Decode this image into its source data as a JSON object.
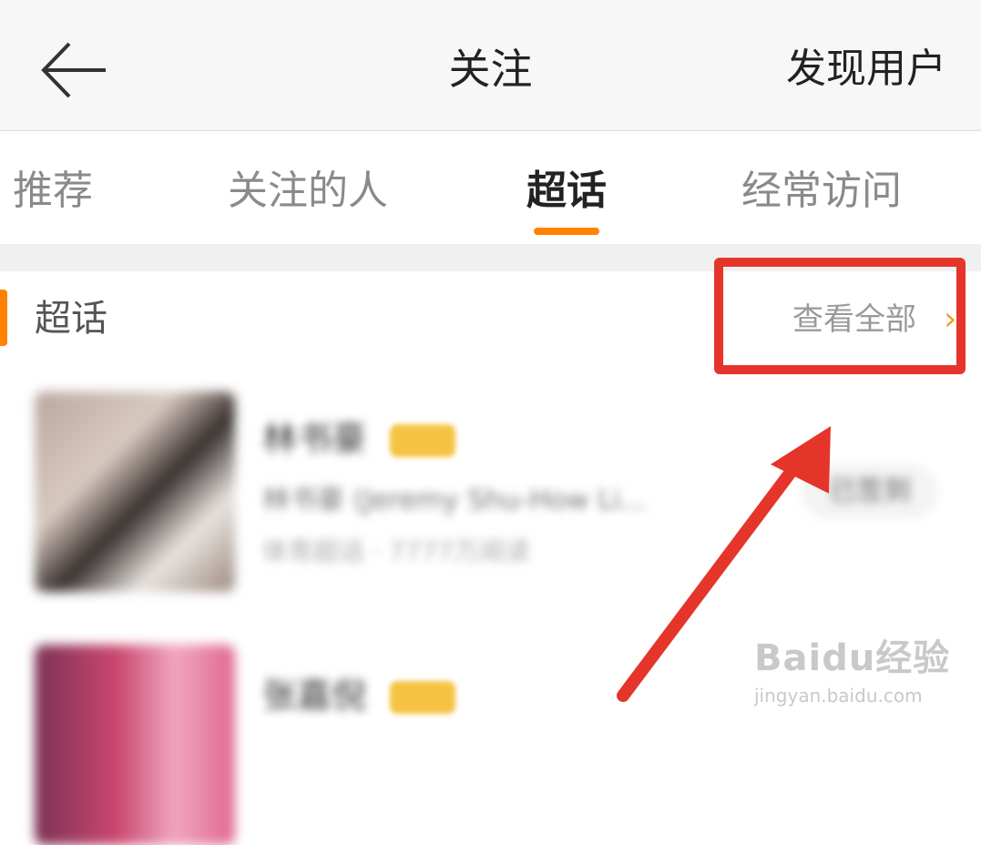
{
  "header": {
    "title": "关注",
    "discover_label": "发现用户"
  },
  "tabs": [
    {
      "label": "推荐",
      "active": false
    },
    {
      "label": "关注的人",
      "active": false
    },
    {
      "label": "超话",
      "active": true
    },
    {
      "label": "经常访问",
      "active": false
    }
  ],
  "section": {
    "title": "超话",
    "view_all_label": "查看全部",
    "chevron": "›"
  },
  "list": [
    {
      "name": "林书豪",
      "desc": "林书豪 (Jeremy Shu-How Li...",
      "sub": "体育超话 · 7777万阅读"
    },
    {
      "name": "张嘉倪"
    }
  ],
  "checkin_label": "已签到",
  "colors": {
    "accent": "#ff8200",
    "highlight": "#e5352b",
    "chevron": "#f0a020"
  },
  "icons": {
    "back": "arrow-left-icon"
  },
  "watermark": {
    "logo": "Baidu经验",
    "url": "jingyan.baidu.com"
  }
}
